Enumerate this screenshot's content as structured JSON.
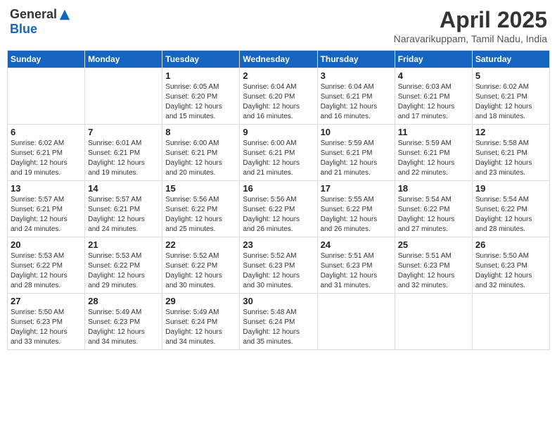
{
  "logo": {
    "general": "General",
    "blue": "Blue"
  },
  "header": {
    "month_year": "April 2025",
    "location": "Naravarikuppam, Tamil Nadu, India"
  },
  "weekdays": [
    "Sunday",
    "Monday",
    "Tuesday",
    "Wednesday",
    "Thursday",
    "Friday",
    "Saturday"
  ],
  "weeks": [
    [
      {
        "day": "",
        "info": ""
      },
      {
        "day": "",
        "info": ""
      },
      {
        "day": "1",
        "info": "Sunrise: 6:05 AM\nSunset: 6:20 PM\nDaylight: 12 hours\nand 15 minutes."
      },
      {
        "day": "2",
        "info": "Sunrise: 6:04 AM\nSunset: 6:20 PM\nDaylight: 12 hours\nand 16 minutes."
      },
      {
        "day": "3",
        "info": "Sunrise: 6:04 AM\nSunset: 6:21 PM\nDaylight: 12 hours\nand 16 minutes."
      },
      {
        "day": "4",
        "info": "Sunrise: 6:03 AM\nSunset: 6:21 PM\nDaylight: 12 hours\nand 17 minutes."
      },
      {
        "day": "5",
        "info": "Sunrise: 6:02 AM\nSunset: 6:21 PM\nDaylight: 12 hours\nand 18 minutes."
      }
    ],
    [
      {
        "day": "6",
        "info": "Sunrise: 6:02 AM\nSunset: 6:21 PM\nDaylight: 12 hours\nand 19 minutes."
      },
      {
        "day": "7",
        "info": "Sunrise: 6:01 AM\nSunset: 6:21 PM\nDaylight: 12 hours\nand 19 minutes."
      },
      {
        "day": "8",
        "info": "Sunrise: 6:00 AM\nSunset: 6:21 PM\nDaylight: 12 hours\nand 20 minutes."
      },
      {
        "day": "9",
        "info": "Sunrise: 6:00 AM\nSunset: 6:21 PM\nDaylight: 12 hours\nand 21 minutes."
      },
      {
        "day": "10",
        "info": "Sunrise: 5:59 AM\nSunset: 6:21 PM\nDaylight: 12 hours\nand 21 minutes."
      },
      {
        "day": "11",
        "info": "Sunrise: 5:59 AM\nSunset: 6:21 PM\nDaylight: 12 hours\nand 22 minutes."
      },
      {
        "day": "12",
        "info": "Sunrise: 5:58 AM\nSunset: 6:21 PM\nDaylight: 12 hours\nand 23 minutes."
      }
    ],
    [
      {
        "day": "13",
        "info": "Sunrise: 5:57 AM\nSunset: 6:21 PM\nDaylight: 12 hours\nand 24 minutes."
      },
      {
        "day": "14",
        "info": "Sunrise: 5:57 AM\nSunset: 6:21 PM\nDaylight: 12 hours\nand 24 minutes."
      },
      {
        "day": "15",
        "info": "Sunrise: 5:56 AM\nSunset: 6:22 PM\nDaylight: 12 hours\nand 25 minutes."
      },
      {
        "day": "16",
        "info": "Sunrise: 5:56 AM\nSunset: 6:22 PM\nDaylight: 12 hours\nand 26 minutes."
      },
      {
        "day": "17",
        "info": "Sunrise: 5:55 AM\nSunset: 6:22 PM\nDaylight: 12 hours\nand 26 minutes."
      },
      {
        "day": "18",
        "info": "Sunrise: 5:54 AM\nSunset: 6:22 PM\nDaylight: 12 hours\nand 27 minutes."
      },
      {
        "day": "19",
        "info": "Sunrise: 5:54 AM\nSunset: 6:22 PM\nDaylight: 12 hours\nand 28 minutes."
      }
    ],
    [
      {
        "day": "20",
        "info": "Sunrise: 5:53 AM\nSunset: 6:22 PM\nDaylight: 12 hours\nand 28 minutes."
      },
      {
        "day": "21",
        "info": "Sunrise: 5:53 AM\nSunset: 6:22 PM\nDaylight: 12 hours\nand 29 minutes."
      },
      {
        "day": "22",
        "info": "Sunrise: 5:52 AM\nSunset: 6:22 PM\nDaylight: 12 hours\nand 30 minutes."
      },
      {
        "day": "23",
        "info": "Sunrise: 5:52 AM\nSunset: 6:23 PM\nDaylight: 12 hours\nand 30 minutes."
      },
      {
        "day": "24",
        "info": "Sunrise: 5:51 AM\nSunset: 6:23 PM\nDaylight: 12 hours\nand 31 minutes."
      },
      {
        "day": "25",
        "info": "Sunrise: 5:51 AM\nSunset: 6:23 PM\nDaylight: 12 hours\nand 32 minutes."
      },
      {
        "day": "26",
        "info": "Sunrise: 5:50 AM\nSunset: 6:23 PM\nDaylight: 12 hours\nand 32 minutes."
      }
    ],
    [
      {
        "day": "27",
        "info": "Sunrise: 5:50 AM\nSunset: 6:23 PM\nDaylight: 12 hours\nand 33 minutes."
      },
      {
        "day": "28",
        "info": "Sunrise: 5:49 AM\nSunset: 6:23 PM\nDaylight: 12 hours\nand 34 minutes."
      },
      {
        "day": "29",
        "info": "Sunrise: 5:49 AM\nSunset: 6:24 PM\nDaylight: 12 hours\nand 34 minutes."
      },
      {
        "day": "30",
        "info": "Sunrise: 5:48 AM\nSunset: 6:24 PM\nDaylight: 12 hours\nand 35 minutes."
      },
      {
        "day": "",
        "info": ""
      },
      {
        "day": "",
        "info": ""
      },
      {
        "day": "",
        "info": ""
      }
    ]
  ]
}
